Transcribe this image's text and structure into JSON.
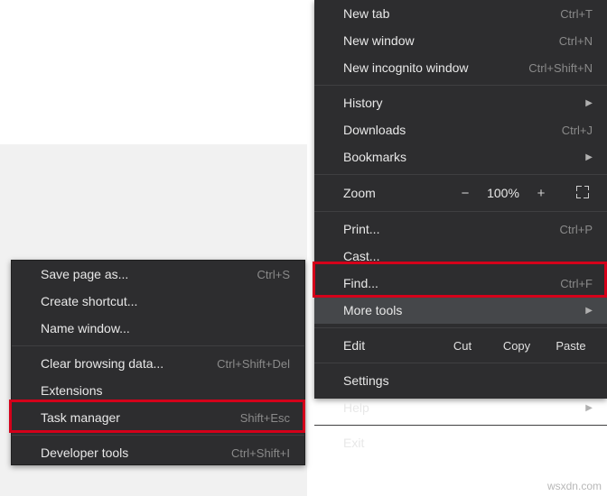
{
  "main_menu": {
    "new_tab": {
      "label": "New tab",
      "shortcut": "Ctrl+T"
    },
    "new_window": {
      "label": "New window",
      "shortcut": "Ctrl+N"
    },
    "new_incognito": {
      "label": "New incognito window",
      "shortcut": "Ctrl+Shift+N"
    },
    "history": {
      "label": "History"
    },
    "downloads": {
      "label": "Downloads",
      "shortcut": "Ctrl+J"
    },
    "bookmarks": {
      "label": "Bookmarks"
    },
    "zoom": {
      "label": "Zoom",
      "minus": "−",
      "value": "100%",
      "plus": "+"
    },
    "print": {
      "label": "Print...",
      "shortcut": "Ctrl+P"
    },
    "cast": {
      "label": "Cast..."
    },
    "find": {
      "label": "Find...",
      "shortcut": "Ctrl+F"
    },
    "more_tools": {
      "label": "More tools"
    },
    "edit": {
      "label": "Edit",
      "cut": "Cut",
      "copy": "Copy",
      "paste": "Paste"
    },
    "settings": {
      "label": "Settings"
    },
    "help": {
      "label": "Help"
    },
    "exit": {
      "label": "Exit"
    }
  },
  "sub_menu": {
    "save_page": {
      "label": "Save page as...",
      "shortcut": "Ctrl+S"
    },
    "create_shortcut": {
      "label": "Create shortcut..."
    },
    "name_window": {
      "label": "Name window..."
    },
    "clear_browsing": {
      "label": "Clear browsing data...",
      "shortcut": "Ctrl+Shift+Del"
    },
    "extensions": {
      "label": "Extensions"
    },
    "task_manager": {
      "label": "Task manager",
      "shortcut": "Shift+Esc"
    },
    "developer_tools": {
      "label": "Developer tools",
      "shortcut": "Ctrl+Shift+I"
    }
  },
  "watermark": "wsxdn.com"
}
